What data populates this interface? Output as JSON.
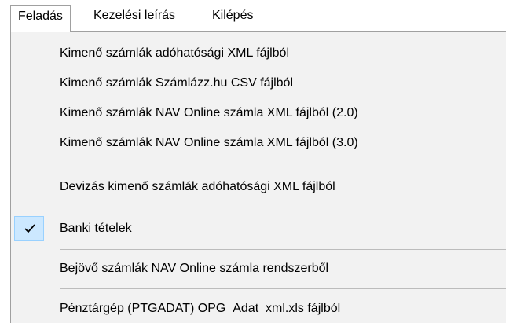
{
  "menubar": {
    "items": [
      {
        "label": "Feladás",
        "active": true
      },
      {
        "label": "Kezelési leírás",
        "active": false
      },
      {
        "label": "Kilépés",
        "active": false
      }
    ]
  },
  "dropdown": {
    "groups": [
      {
        "items": [
          {
            "label": "Kimenő számlák adóhatósági XML fájlból"
          },
          {
            "label": "Kimenő számlák Számlázz.hu CSV fájlból"
          },
          {
            "label": "Kimenő számlák NAV Online számla XML fájlból (2.0)"
          },
          {
            "label": "Kimenő számlák NAV Online számla XML fájlból (3.0)"
          }
        ]
      },
      {
        "items": [
          {
            "label": "Devizás kimenő számlák adóhatósági XML fájlból"
          }
        ]
      },
      {
        "items": [
          {
            "label": "Banki tételek",
            "checked": true,
            "icon": "checkmark-icon"
          }
        ]
      },
      {
        "items": [
          {
            "label": "Bejövő számlák NAV Online számla rendszerből"
          }
        ]
      },
      {
        "items": [
          {
            "label": "Pénztárgép (PTGADAT) OPG_Adat_xml.xls fájlból"
          }
        ]
      }
    ]
  },
  "colors": {
    "menu_background": "#f2f2f2",
    "checked_highlight": "#cce8ff",
    "checked_border": "#99d1ff",
    "separator": "#bcbcbc"
  }
}
